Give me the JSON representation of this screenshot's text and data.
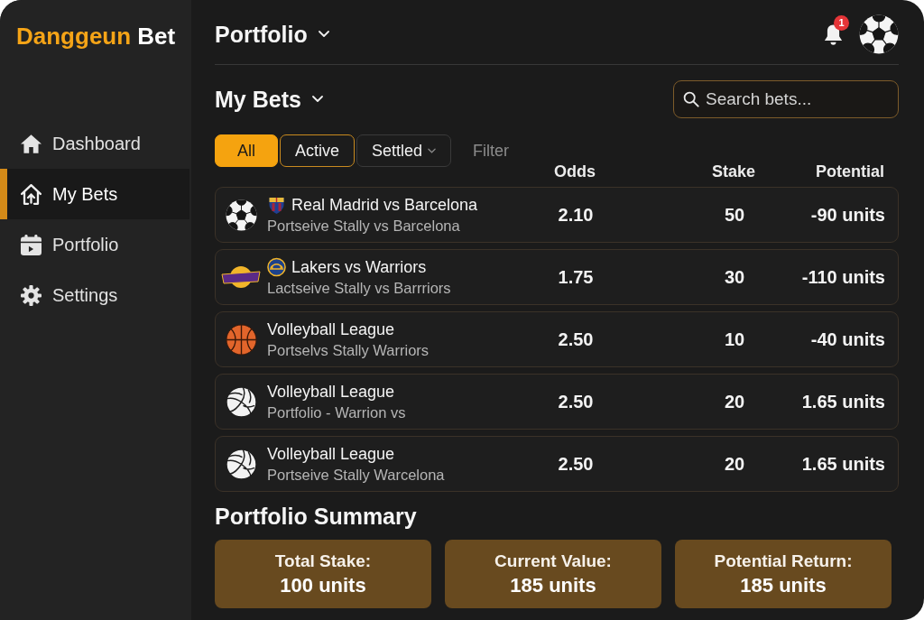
{
  "sidebar": {
    "logo": {
      "brand": "Danggeun",
      "suffix": "Bet"
    },
    "items": [
      {
        "label": "Dashboard",
        "kind": "home",
        "selected": false
      },
      {
        "label": "My Bets",
        "kind": "bets",
        "selected": true
      },
      {
        "label": "Portfolio",
        "kind": "calendar",
        "selected": false
      },
      {
        "label": "Settings",
        "kind": "settings",
        "selected": false
      }
    ]
  },
  "header": {
    "title": "Portfolio",
    "notifications": "1"
  },
  "bets": {
    "title": "My Bets",
    "search": {
      "placeholder": "Search bets..."
    },
    "filters": [
      {
        "label": "All",
        "selected": true,
        "focused": false,
        "dropdown": false
      },
      {
        "label": "Active",
        "selected": false,
        "focused": true,
        "dropdown": false
      },
      {
        "label": "Settled",
        "selected": false,
        "focused": false,
        "dropdown": true
      }
    ],
    "filter_label": "Filter",
    "columns": [
      "Odds",
      "Stake",
      "Potential"
    ],
    "rows": [
      {
        "kind": "soccer",
        "title": "Real Madrid vs Barcelona",
        "subtitle": "Portseive Stally vs Barcelona",
        "odds": "2.10",
        "stake": "50",
        "potential": "-90 units"
      },
      {
        "kind": "basketball-team",
        "title": "Lakers vs Warriors",
        "subtitle": "Lactseive Stally vs Barrriors",
        "odds": "1.75",
        "stake": "30",
        "potential": "-110 units"
      },
      {
        "kind": "basketball",
        "title": "Volleyball League",
        "subtitle": "Portselvs Stally Warriors",
        "odds": "2.50",
        "stake": "10",
        "potential": "-40 units"
      },
      {
        "kind": "volleyball",
        "title": "Volleyball League",
        "subtitle": "Portfolio - Warrion vs",
        "odds": "2.50",
        "stake": "20",
        "potential": "1.65 units"
      },
      {
        "kind": "volleyball",
        "title": "Volleyball League",
        "subtitle": "Portseive Stally Warcelona",
        "odds": "2.50",
        "stake": "20",
        "potential": "1.65 units"
      }
    ]
  },
  "summary": {
    "title": "Portfolio Summary",
    "cards": [
      {
        "label": "Total Stake:",
        "value": "100 units"
      },
      {
        "label": "Current Value:",
        "value": "185 units"
      },
      {
        "label": "Potential Return:",
        "value": "185 units"
      }
    ]
  }
}
